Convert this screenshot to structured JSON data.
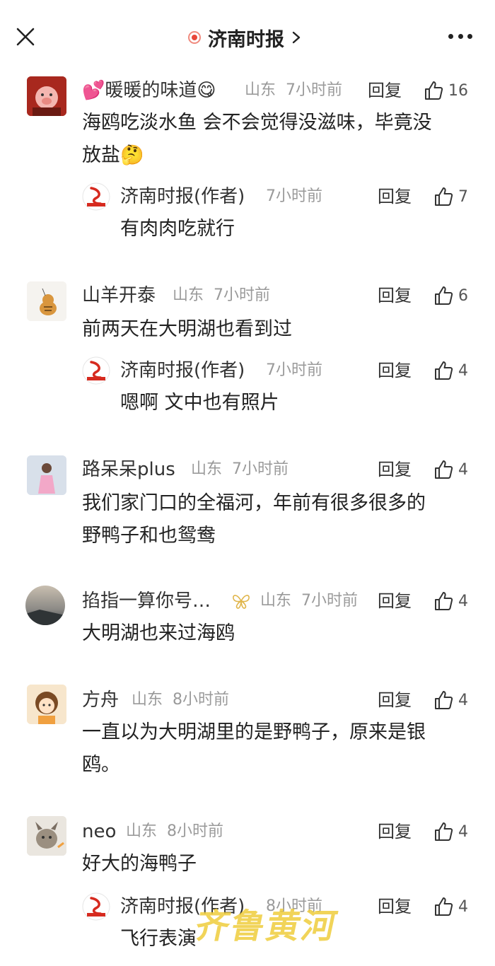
{
  "header": {
    "title": "济南时报",
    "chevron": "›"
  },
  "comments": [
    {
      "user": "暖暖的味道",
      "prefix_emoji": "💕",
      "suffix_emoji": "😋",
      "location": "山东",
      "time": "7小时前",
      "reply_label": "回复",
      "likes": "16",
      "text_lines": [
        "海鸥吃淡水鱼 会不会觉得没滋味，毕竟没",
        "放盐🤔"
      ],
      "replies": [
        {
          "user": "济南时报(作者)",
          "time": "7小时前",
          "reply_label": "回复",
          "likes": "7",
          "text": "有肉肉吃就行"
        }
      ]
    },
    {
      "user": "山羊开泰",
      "location": "山东",
      "time": "7小时前",
      "reply_label": "回复",
      "likes": "6",
      "text_lines": [
        "前两天在大明湖也看到过"
      ],
      "replies": [
        {
          "user": "济南时报(作者)",
          "time": "7小时前",
          "reply_label": "回复",
          "likes": "4",
          "text": "嗯啊 文中也有照片"
        }
      ]
    },
    {
      "user": "路呆呆plus",
      "location": "山东",
      "time": "7小时前",
      "reply_label": "回复",
      "likes": "4",
      "text_lines": [
        "我们家门口的全福河，年前有很多很多的",
        "野鸭子和也鸳鸯"
      ]
    },
    {
      "user": "掐指一算你号…",
      "location": "山东",
      "time": "7小时前",
      "reply_label": "回复",
      "likes": "4",
      "text_lines": [
        "大明湖也来过海鸥"
      ]
    },
    {
      "user": "方舟",
      "location": "山东",
      "time": "8小时前",
      "reply_label": "回复",
      "likes": "4",
      "text_lines": [
        "一直以为大明湖里的是野鸭子，原来是银",
        "鸥。"
      ]
    },
    {
      "user": "neo",
      "location": "山东",
      "time": "8小时前",
      "reply_label": "回复",
      "likes": "4",
      "text_lines": [
        "好大的海鸭子"
      ],
      "replies": [
        {
          "user": "济南时报(作者)",
          "time": "8小时前",
          "reply_label": "回复",
          "likes": "4",
          "text": "飞行表演"
        }
      ]
    }
  ],
  "watermark": "齐鲁黄河",
  "colors": {
    "accent_red": "#e8473a",
    "meta_gray": "#9a9a9a",
    "watermark_yellow": "#eecc3c"
  }
}
